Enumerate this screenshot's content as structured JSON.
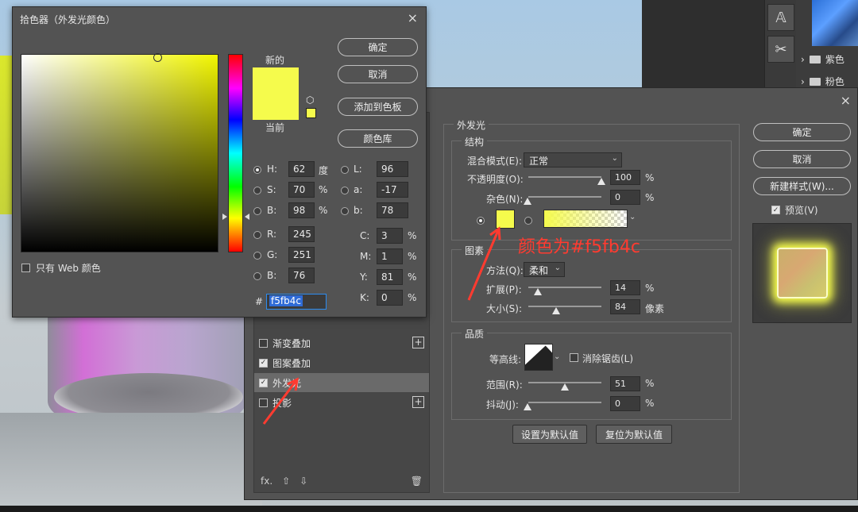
{
  "color_picker": {
    "title": "拾色器（外发光颜色）",
    "close": "×",
    "buttons": {
      "ok": "确定",
      "cancel": "取消",
      "add_to_swatches": "添加到色板",
      "color_libraries": "颜色库"
    },
    "label_new": "新的",
    "label_current": "当前",
    "only_web_colors": "只有 Web 颜色",
    "fields": {
      "H": {
        "label": "H:",
        "value": "62",
        "unit": "度"
      },
      "S": {
        "label": "S:",
        "value": "70",
        "unit": "%"
      },
      "B": {
        "label": "B:",
        "value": "98",
        "unit": "%"
      },
      "R": {
        "label": "R:",
        "value": "245"
      },
      "G": {
        "label": "G:",
        "value": "251"
      },
      "Bv": {
        "label": "B:",
        "value": "76"
      },
      "L": {
        "label": "L:",
        "value": "96"
      },
      "a": {
        "label": "a:",
        "value": "-17"
      },
      "b": {
        "label": "b:",
        "value": "78"
      },
      "C": {
        "label": "C:",
        "value": "3",
        "unit": "%"
      },
      "M": {
        "label": "M:",
        "value": "1",
        "unit": "%"
      },
      "Y": {
        "label": "Y:",
        "value": "81",
        "unit": "%"
      },
      "K": {
        "label": "K:",
        "value": "0",
        "unit": "%"
      }
    },
    "hex_label": "#",
    "hex_value": "f5fb4c",
    "selected_color": "#f5fb4c"
  },
  "layer_style": {
    "close": "×",
    "styles_list": [
      {
        "label": "渐变叠加",
        "checked": false,
        "has_plus": true
      },
      {
        "label": "图案叠加",
        "checked": true,
        "has_plus": false
      },
      {
        "label": "外发光",
        "checked": true,
        "has_plus": false,
        "active": true
      },
      {
        "label": "投影",
        "checked": false,
        "has_plus": true
      }
    ],
    "bottom_bar": {
      "fx": "fx.",
      "up": "⇧",
      "down": "⇩",
      "trash": "🗑"
    },
    "outer_glow": {
      "title": "外发光",
      "structure": {
        "title": "结构",
        "blend_mode_label": "混合模式(E):",
        "blend_mode_value": "正常",
        "opacity_label": "不透明度(O):",
        "opacity_value": "100",
        "opacity_unit": "%",
        "noise_label": "杂色(N):",
        "noise_value": "0",
        "noise_unit": "%"
      },
      "elements": {
        "title": "图素",
        "technique_label": "方法(Q):",
        "technique_value": "柔和",
        "spread_label": "扩展(P):",
        "spread_value": "14",
        "spread_unit": "%",
        "size_label": "大小(S):",
        "size_value": "84",
        "size_unit": "像素"
      },
      "quality": {
        "title": "品质",
        "contour_label": "等高线:",
        "anti_alias_label": "消除锯齿(L)",
        "range_label": "范围(R):",
        "range_value": "51",
        "range_unit": "%",
        "jitter_label": "抖动(J):",
        "jitter_value": "0",
        "jitter_unit": "%"
      },
      "make_default": "设置为默认值",
      "reset_default": "复位为默认值"
    },
    "right_buttons": {
      "ok": "确定",
      "cancel": "取消",
      "new_style": "新建样式(W)...",
      "preview": "预览(V)"
    }
  },
  "side_panel": {
    "folders": [
      {
        "label": "紫色"
      },
      {
        "label": "粉色"
      }
    ],
    "tool_icons": [
      "type-tool-icon",
      "scissors-tool-icon"
    ]
  },
  "annotation": {
    "text": "颜色为#f5fb4c",
    "color": "#ff3b30"
  }
}
